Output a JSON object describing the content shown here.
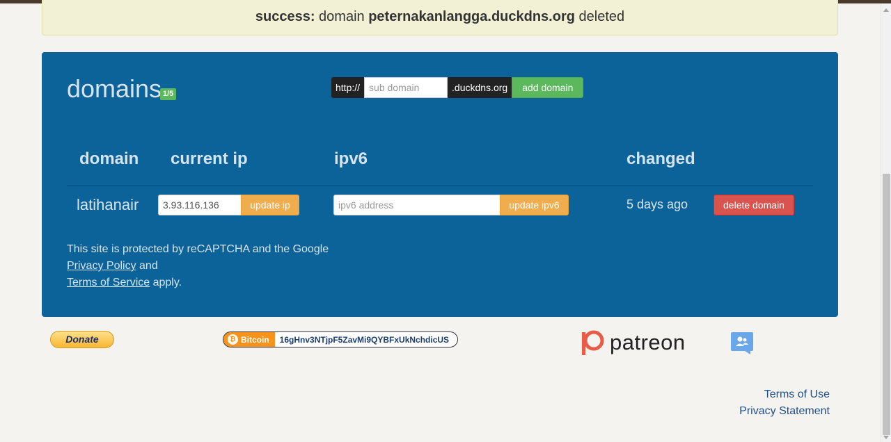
{
  "alert": {
    "prefix": "success:",
    "text_before": " domain ",
    "domain": "peternakanlangga.duckdns.org",
    "text_after": " deleted"
  },
  "panel": {
    "title": "domains",
    "count_badge": "1/5",
    "add_form": {
      "prefix": "http://",
      "placeholder": "sub domain",
      "suffix": ".duckdns.org",
      "button": "add domain"
    },
    "table": {
      "headers": [
        "domain",
        "current ip",
        "ipv6",
        "changed"
      ],
      "rows": [
        {
          "domain": "latihanair",
          "current_ip": "3.93.116.136",
          "update_ip_label": "update ip",
          "ipv6_placeholder": "ipv6 address",
          "update_ipv6_label": "update ipv6",
          "changed": "5 days ago",
          "delete_label": "delete domain"
        }
      ]
    },
    "captcha": {
      "line1": "This site is protected by reCAPTCHA and the Google",
      "privacy_link": "Privacy Policy",
      "and": " and",
      "terms_link": "Terms of Service",
      "apply": " apply."
    }
  },
  "donations": {
    "donate_label": "Donate",
    "bitcoin_label": "Bitcoin",
    "bitcoin_address": "16gHnv3NTjpF5ZavMi9QYBFxUkNchdicUS",
    "patreon_label": "patreon"
  },
  "footer": {
    "terms": "Terms of Use",
    "privacy": "Privacy Statement"
  },
  "colors": {
    "panel": "#0b6399",
    "success_bg": "#f2f1d5",
    "green": "#5cb85c",
    "orange": "#f0ad4e",
    "red": "#d9534f",
    "patreon": "#e85b46",
    "bitcoin": "#f7931a"
  },
  "icons": [
    "bitcoin-icon",
    "patreon-icon",
    "contact-card-icon"
  ]
}
